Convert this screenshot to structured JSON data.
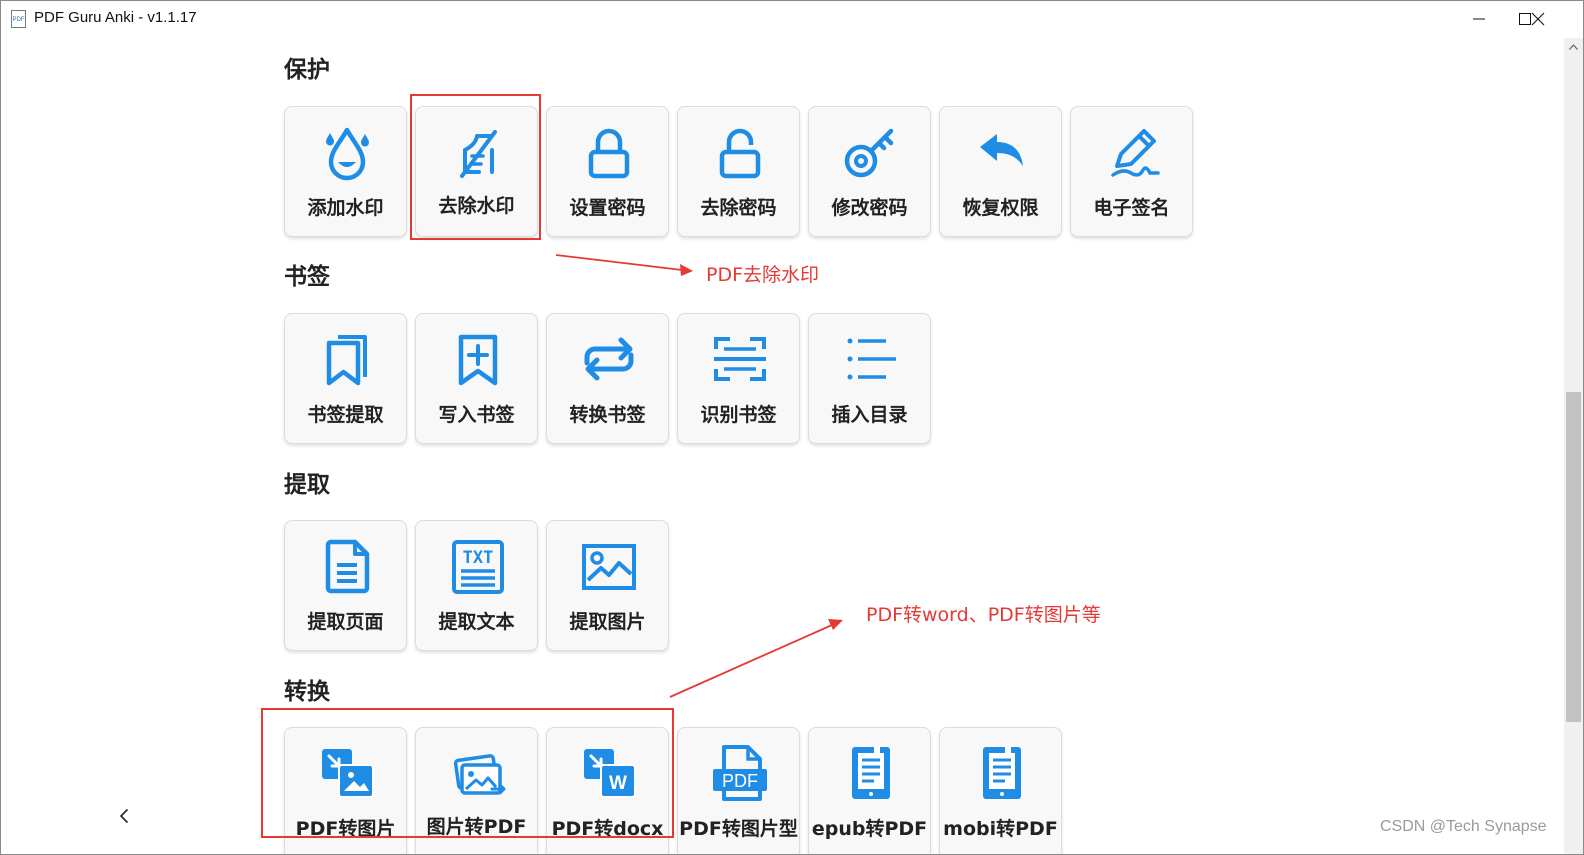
{
  "window": {
    "title": "PDF Guru Anki - v1.1.17",
    "app_icon_text": "PDF"
  },
  "accent_color": "#1f8ce6",
  "sections": {
    "protect": {
      "title": "保护",
      "tiles": [
        "添加水印",
        "去除水印",
        "设置密码",
        "去除密码",
        "修改密码",
        "恢复权限",
        "电子签名"
      ]
    },
    "bookmark": {
      "title": "书签",
      "tiles": [
        "书签提取",
        "写入书签",
        "转换书签",
        "识别书签",
        "插入目录"
      ]
    },
    "extract": {
      "title": "提取",
      "tiles": [
        "提取页面",
        "提取文本",
        "提取图片"
      ]
    },
    "convert": {
      "title": "转换",
      "tiles": [
        "PDF转图片",
        "图片转PDF",
        "PDF转docx",
        "PDF转图片型",
        "epub转PDF",
        "mobi转PDF"
      ]
    }
  },
  "icons": {
    "txt_label": "TXT",
    "pdf_label": "PDF",
    "word_label": "W"
  },
  "annotations": {
    "remove_watermark": "PDF去除水印",
    "convert": "PDF转word、PDF转图片等",
    "color": "#e53935"
  },
  "watermark": "CSDN @Tech Synapse"
}
